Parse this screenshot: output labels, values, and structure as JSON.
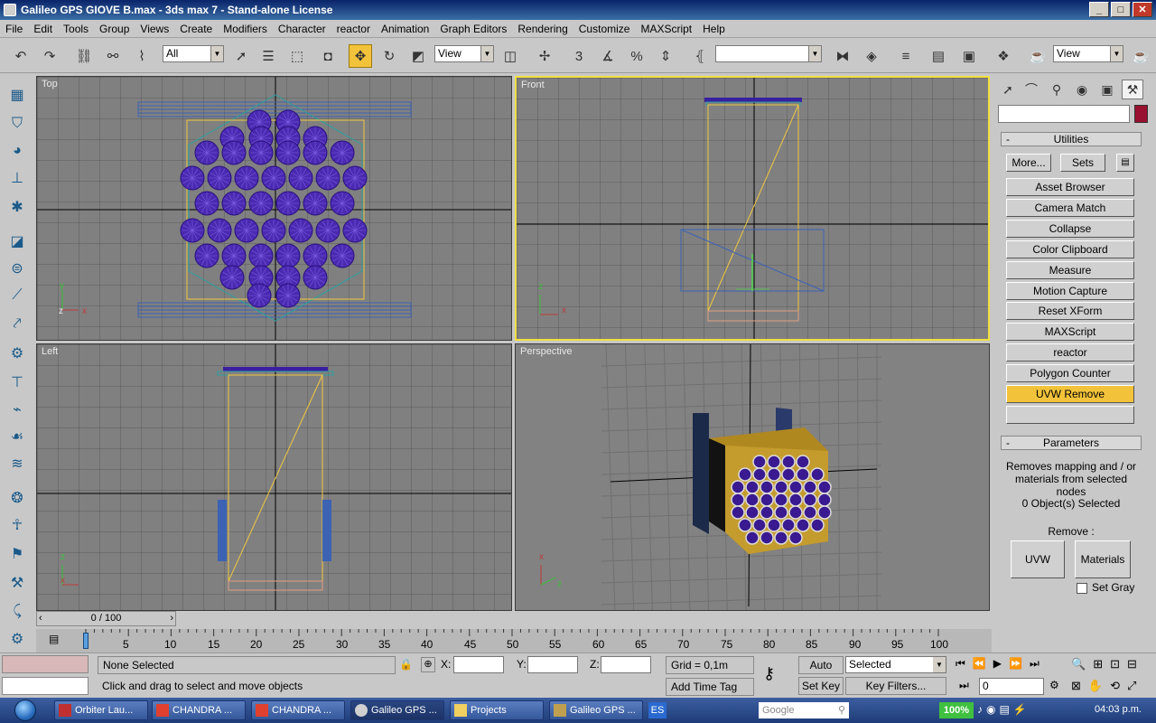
{
  "window": {
    "title": "Galileo GPS GIOVE B.max - 3ds max 7  - Stand-alone License",
    "minimize": "_",
    "maximize": "□",
    "close": "✕"
  },
  "menu": [
    "File",
    "Edit",
    "Tools",
    "Group",
    "Views",
    "Create",
    "Modifiers",
    "Character",
    "reactor",
    "Animation",
    "Graph Editors",
    "Rendering",
    "Customize",
    "MAXScript",
    "Help"
  ],
  "toolbar": {
    "selection_filter": "All",
    "ref_coord": "View",
    "named_selection": "",
    "render_view": "View",
    "snap_angle_label": "3",
    "percent_label": "%"
  },
  "viewports": {
    "top": "Top",
    "front": "Front",
    "left": "Left",
    "perspective": "Perspective",
    "axis_x": "x",
    "axis_y": "y",
    "axis_z": "z"
  },
  "command_panel": {
    "utilities_title": "Utilities",
    "more_label": "More...",
    "sets_label": "Sets",
    "utilities": [
      "Asset Browser",
      "Camera Match",
      "Collapse",
      "Color Clipboard",
      "Measure",
      "Motion Capture",
      "Reset XForm",
      "MAXScript",
      "reactor",
      "Polygon Counter",
      "UVW Remove"
    ],
    "parameters_title": "Parameters",
    "description": "Removes mapping and / or materials from selected nodes",
    "selected_count": "0 Object(s) Selected",
    "remove_label": "Remove :",
    "uvw_label": "UVW",
    "materials_label": "Materials",
    "set_gray_label": "Set Gray",
    "minus": "-"
  },
  "timeline": {
    "frame_display": "0 / 100",
    "ticks": [
      "0",
      "5",
      "10",
      "15",
      "20",
      "25",
      "30",
      "35",
      "40",
      "45",
      "50",
      "55",
      "60",
      "65",
      "70",
      "75",
      "80",
      "85",
      "90",
      "95",
      "100"
    ]
  },
  "status": {
    "selection": "None Selected",
    "prompt": "Click and drag to select and move objects",
    "x_label": "X:",
    "y_label": "Y:",
    "z_label": "Z:",
    "grid": "Grid = 0,1m",
    "add_time_tag": "Add Time Tag",
    "auto_key": "Auto Key",
    "set_key": "Set Key",
    "key_mode": "Selected",
    "key_filters": "Key Filters...",
    "current_frame": "0"
  },
  "taskbar": {
    "items": [
      "Orbiter Lau...",
      "CHANDRA ...",
      "CHANDRA ...",
      "Galileo GPS ...",
      "Projects",
      "Galileo GPS ..."
    ],
    "lang": "ES",
    "search": "Google",
    "battery": "100%",
    "clock": "04:03 p.m."
  },
  "colors": {
    "accent": "#f2c33a",
    "viewport_bg": "#808080",
    "active_border": "#f0e040",
    "satellite_wire": "#3a2aa0",
    "frame_wire": "#f0c840"
  }
}
